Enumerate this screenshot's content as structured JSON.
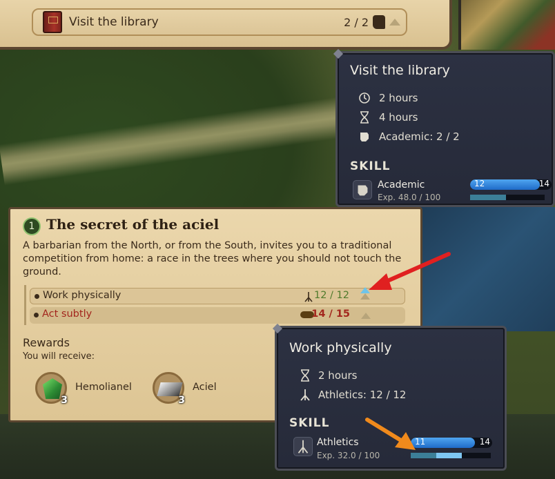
{
  "topbar": {
    "task_title": "Visit the library",
    "task_progress": "2 / 2"
  },
  "library_tooltip": {
    "title": "Visit the library",
    "rows": [
      {
        "icon": "clock-icon",
        "text": "2 hours"
      },
      {
        "icon": "hourglass-icon",
        "text": "4 hours"
      },
      {
        "icon": "fist-icon",
        "text": "Academic: 2 / 2"
      }
    ],
    "skill_heading": "SKILL",
    "skill": {
      "name": "Academic",
      "exp": "Exp. 48.0 / 100",
      "current": "12",
      "max": "14",
      "level_fraction": 0.86,
      "exp_fraction": 0.48
    }
  },
  "quest": {
    "number": "1",
    "title": "The secret of the aciel",
    "description": "A barbarian from the North, or from the South, invites you to a traditional competition from home: a race in the trees where you should not touch the ground.",
    "choices": [
      {
        "label": "Work physically",
        "value": "12 / 12",
        "color": "#4f7a2c",
        "icon": "athletics-icon"
      },
      {
        "label": "Act subtly",
        "value": "14 / 15",
        "color": "#a3261d",
        "icon": "mask-icon"
      }
    ],
    "rewards_heading": "Rewards",
    "rewards_sub": "You will receive:",
    "rewards": [
      {
        "name": "Hemolianel",
        "qty": "3",
        "icon": "green-gem-icon"
      },
      {
        "name": "Aciel",
        "qty": "3",
        "icon": "metal-ingot-icon"
      }
    ]
  },
  "work_tooltip": {
    "title": "Work physically",
    "rows": [
      {
        "icon": "hourglass-icon",
        "text": "2 hours"
      },
      {
        "icon": "athletics-icon",
        "text": "Athletics: 12 / 12"
      }
    ],
    "skill_heading": "SKILL",
    "skill": {
      "name": "Athletics",
      "exp": "Exp. 32.0 / 100",
      "current": "11",
      "max": "14",
      "level_fraction": 0.79,
      "exp_fraction": 0.32,
      "exp_gain_fraction": 0.32
    }
  },
  "colors": {
    "skill_heading": "#e8e4d6",
    "annotation_red": "#e02020",
    "annotation_orange": "#f08a1c"
  }
}
